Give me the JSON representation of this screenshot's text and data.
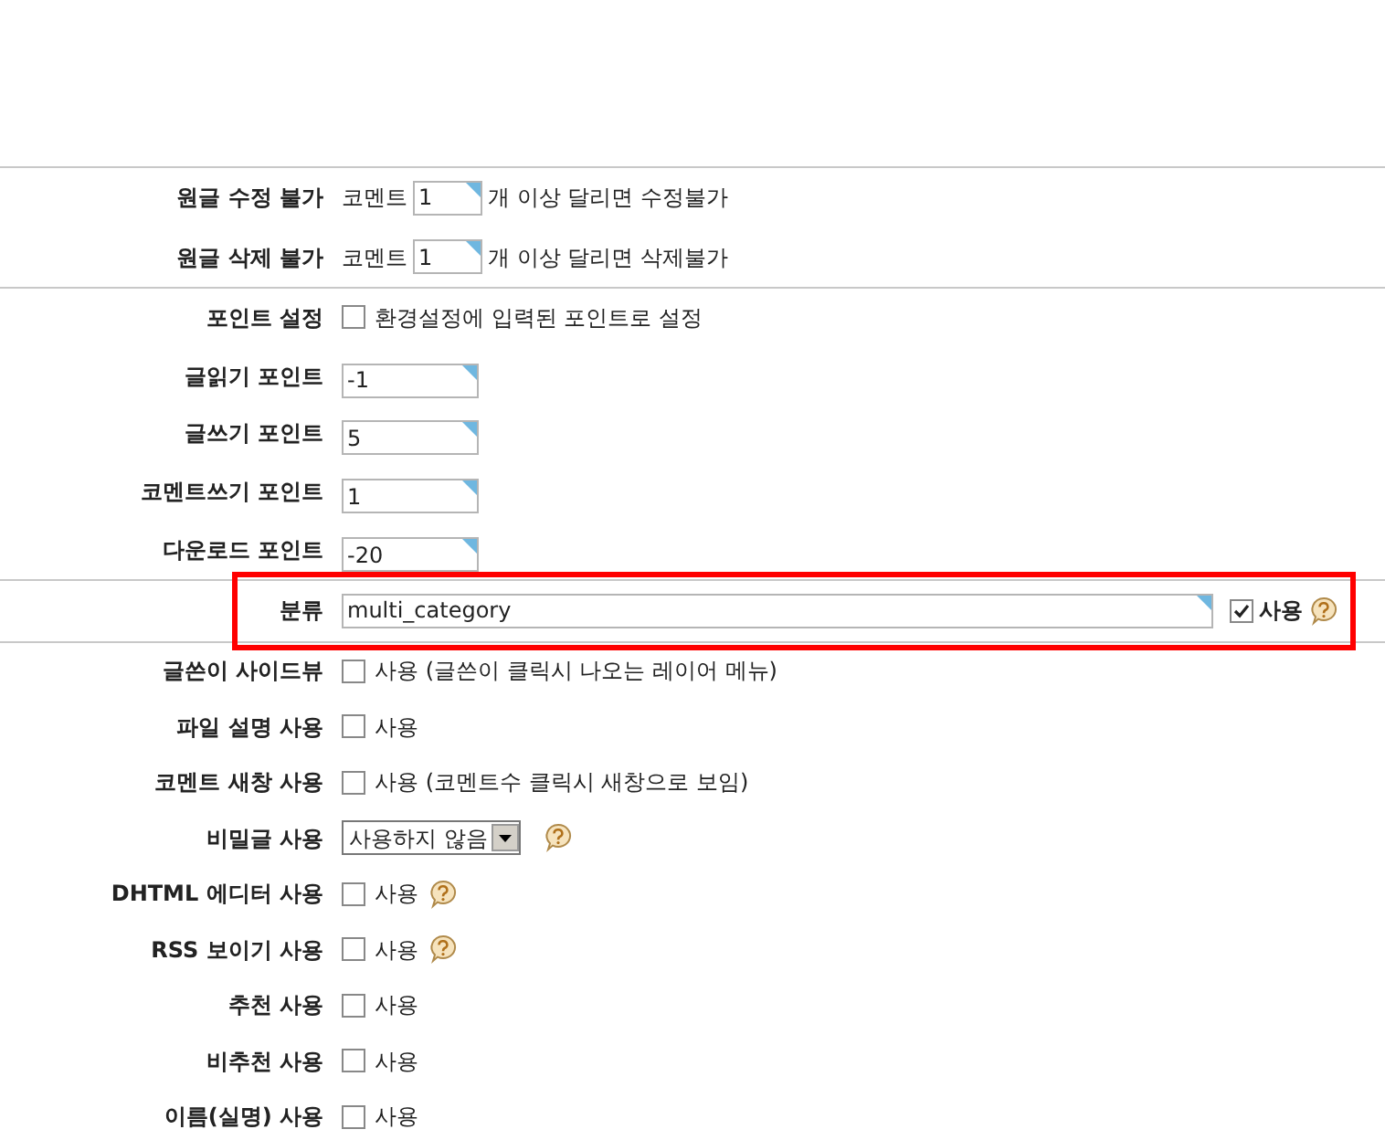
{
  "sections": [
    {
      "highlighted": false,
      "rows": [
        {
          "label": "원글 수정 불가",
          "kind": "comment_limit",
          "prefix": "코멘트",
          "value": "1",
          "suffix": "개 이상 달리면 수정불가"
        },
        {
          "label": "원글 삭제 불가",
          "kind": "comment_limit",
          "prefix": "코멘트",
          "value": "1",
          "suffix": "개 이상 달리면 삭제불가"
        }
      ]
    },
    {
      "highlighted": false,
      "rows": [
        {
          "label": "포인트 설정",
          "kind": "checkbox",
          "checked": false,
          "text": "환경설정에 입력된 포인트로 설정",
          "help": false
        },
        {
          "label": "글읽기 포인트",
          "kind": "input",
          "value": "-1"
        },
        {
          "label": "글쓰기 포인트",
          "kind": "input",
          "value": "5"
        },
        {
          "label": "코멘트쓰기 포인트",
          "kind": "input",
          "value": "1"
        },
        {
          "label": "다운로드 포인트",
          "kind": "input",
          "value": "-20"
        }
      ]
    },
    {
      "highlighted": true,
      "rows": [
        {
          "label": "분류",
          "kind": "category",
          "value": "multi_category",
          "checked": true,
          "text": "사용",
          "help": true
        }
      ]
    },
    {
      "highlighted": false,
      "rows": [
        {
          "label": "글쓴이 사이드뷰",
          "kind": "checkbox",
          "checked": false,
          "text": "사용 (글쓴이 클릭시 나오는 레이어 메뉴)",
          "help": false
        },
        {
          "label": "파일 설명 사용",
          "kind": "checkbox",
          "checked": false,
          "text": "사용",
          "help": false
        },
        {
          "label": "코멘트 새창 사용",
          "kind": "checkbox",
          "checked": false,
          "text": "사용 (코멘트수 클릭시 새창으로 보임)",
          "help": false
        },
        {
          "label": "비밀글 사용",
          "kind": "select",
          "value": "사용하지 않음",
          "help": true
        },
        {
          "label": "DHTML 에디터 사용",
          "kind": "checkbox",
          "checked": false,
          "text": "사용",
          "help": true
        },
        {
          "label": "RSS 보이기 사용",
          "kind": "checkbox",
          "checked": false,
          "text": "사용",
          "help": true
        },
        {
          "label": "추천 사용",
          "kind": "checkbox",
          "checked": false,
          "text": "사용",
          "help": false
        },
        {
          "label": "비추천 사용",
          "kind": "checkbox",
          "checked": false,
          "text": "사용",
          "help": false
        },
        {
          "label": "이름(실명) 사용",
          "kind": "checkbox",
          "checked": false,
          "text": "사용",
          "help": false
        }
      ]
    }
  ]
}
